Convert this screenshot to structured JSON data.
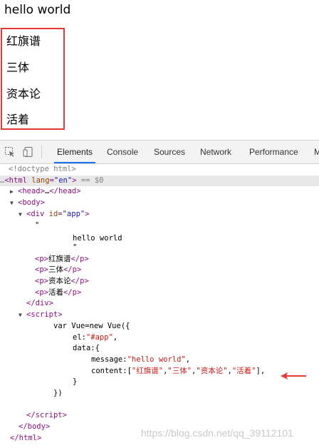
{
  "page": {
    "hello": "hello world",
    "items": [
      "红旗谱",
      "三体",
      "资本论",
      "活着"
    ]
  },
  "devtools": {
    "tabs": [
      "Elements",
      "Console",
      "Sources",
      "Network",
      "Performance",
      "M"
    ],
    "active_tab": "Elements",
    "code_lines": {
      "doctype": "<!doctype html>",
      "html_open": "html",
      "html_lang": "lang",
      "html_lang_val": "\"en\"",
      "html_suffix": " == $0",
      "head": "head",
      "head_collapsed": "…",
      "body": "body",
      "div": "div",
      "div_id": "id",
      "div_id_val": "\"app\"",
      "quote1": "\"",
      "hello_text": "hello world",
      "quote2": "\"",
      "p": "p",
      "p_items": [
        "红旗谱",
        "三体",
        "资本论",
        "活着"
      ],
      "div_close": "div",
      "script": "script",
      "js1": "var Vue=new Vue({",
      "js2_key": "el:",
      "js2_val": "\"#app\"",
      "js2_end": ",",
      "js3": "data:{",
      "js4_key": "message:",
      "js4_val": "\"hello world\"",
      "js4_end": ",",
      "js5_key": "content:[",
      "js5_vals": [
        "\"红旗谱\"",
        "\"三体\"",
        "\"资本论\"",
        "\"活着\""
      ],
      "js5_end": "],",
      "js6": "}",
      "js7": "})",
      "script_close": "script",
      "body_close": "body",
      "html_close": "html"
    }
  },
  "watermark": "https://blog.csdn.net/qq_39112101",
  "colors": {
    "highlight_box": "#e53935",
    "arrow": "#e53935",
    "tab_underline": "#1a73e8"
  }
}
